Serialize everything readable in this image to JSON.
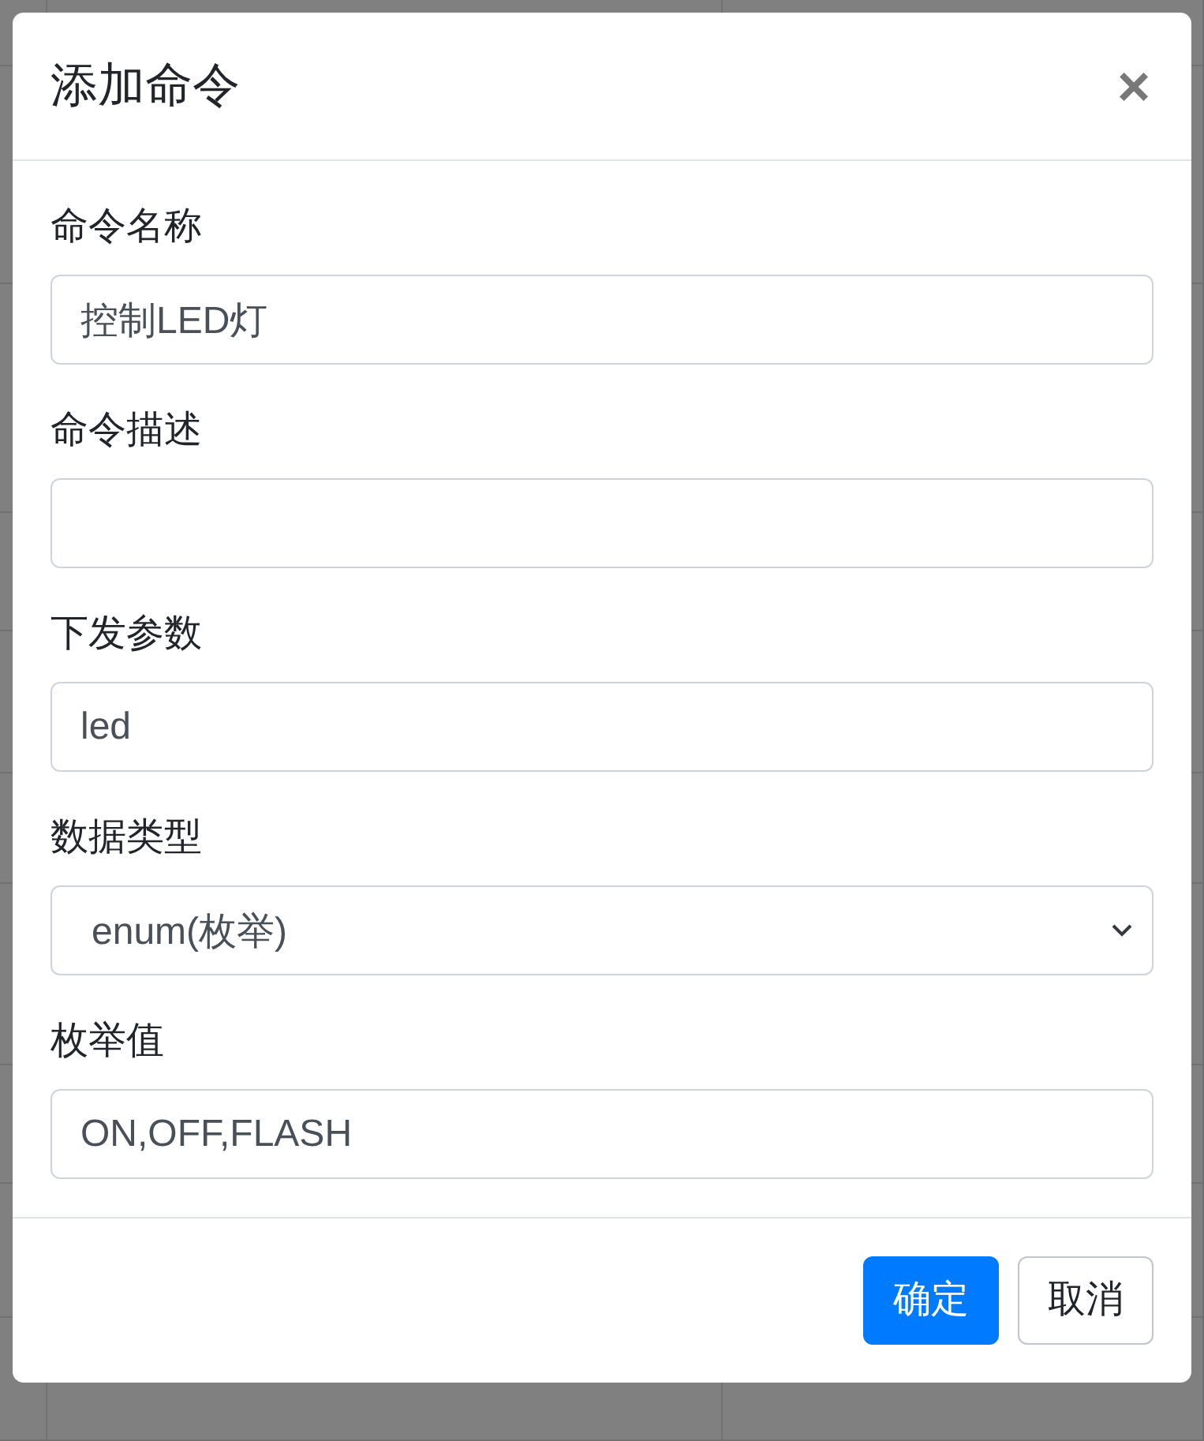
{
  "dialog": {
    "title": "添加命令",
    "close": "×"
  },
  "fields": [
    {
      "kind": "text",
      "label": "命令名称",
      "value": "控制LED灯"
    },
    {
      "kind": "text",
      "label": "命令描述"
    },
    {
      "kind": "text",
      "label": "下发参数",
      "value": "led"
    },
    {
      "kind": "select",
      "label": "数据类型",
      "value": "enum(枚举)"
    },
    {
      "kind": "text",
      "label": "枚举值",
      "value": "ON,OFF,FLASH"
    }
  ],
  "buttons": [
    {
      "label": "确定",
      "kind": "primary"
    },
    {
      "label": "取消",
      "kind": "secondary"
    }
  ]
}
